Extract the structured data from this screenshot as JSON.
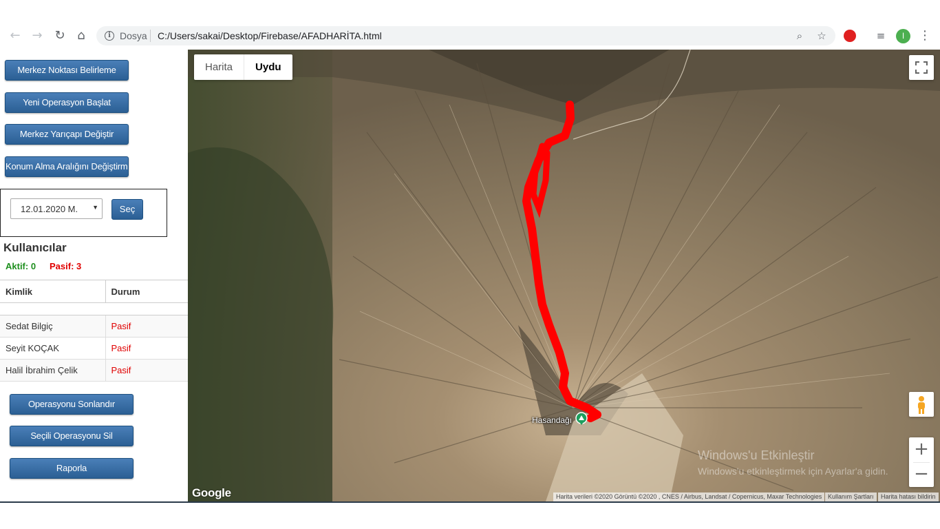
{
  "browser": {
    "scheme_label": "Dosya",
    "url": "C:/Users/sakai/Desktop/Firebase/AFADHARİTA.html",
    "profile_initial": "I"
  },
  "sidebar": {
    "buttons": {
      "set_center": "Merkez Noktası Belirleme",
      "new_operation": "Yeni Operasyon Başlat",
      "change_radius": "Merkez Yarıçapı Değiştir",
      "change_interval": "Konum Alma Aralığını Değiştirme"
    },
    "date_value": "12.01.2020 M.",
    "select_button": "Seç",
    "users_title": "Kullanıcılar",
    "active_count": "Aktif: 0",
    "passive_count": "Pasif: 3",
    "table": {
      "headers": [
        "Kimlik",
        "Durum"
      ],
      "rows": [
        {
          "name": "Sedat Bilgiç",
          "status": "Pasif"
        },
        {
          "name": "Seyit KOÇAK",
          "status": "Pasif"
        },
        {
          "name": "Halil İbrahim Çelik",
          "status": "Pasif"
        }
      ]
    },
    "actions": {
      "end_operation": "Operasyonu Sonlandır",
      "delete_operation": "Seçili Operasyonu Sil",
      "report": "Raporla"
    }
  },
  "map": {
    "type_tabs": [
      "Harita",
      "Uydu"
    ],
    "selected_type": "Uydu",
    "marker_label": "Hasandağı",
    "google_logo": "Google",
    "attribution": "Harita verileri ©2020 Görüntü ©2020 , CNES / Airbus, Landsat / Copernicus, Maxar Technologies",
    "terms": "Kullanım Şartları",
    "report_error": "Harita hatası bildirin",
    "route_color": "#ff0000"
  },
  "watermark": {
    "line1": "Windows'u Etkinleştir",
    "line2": "Windows'u etkinleştirmek için Ayarlar'a gidin."
  }
}
